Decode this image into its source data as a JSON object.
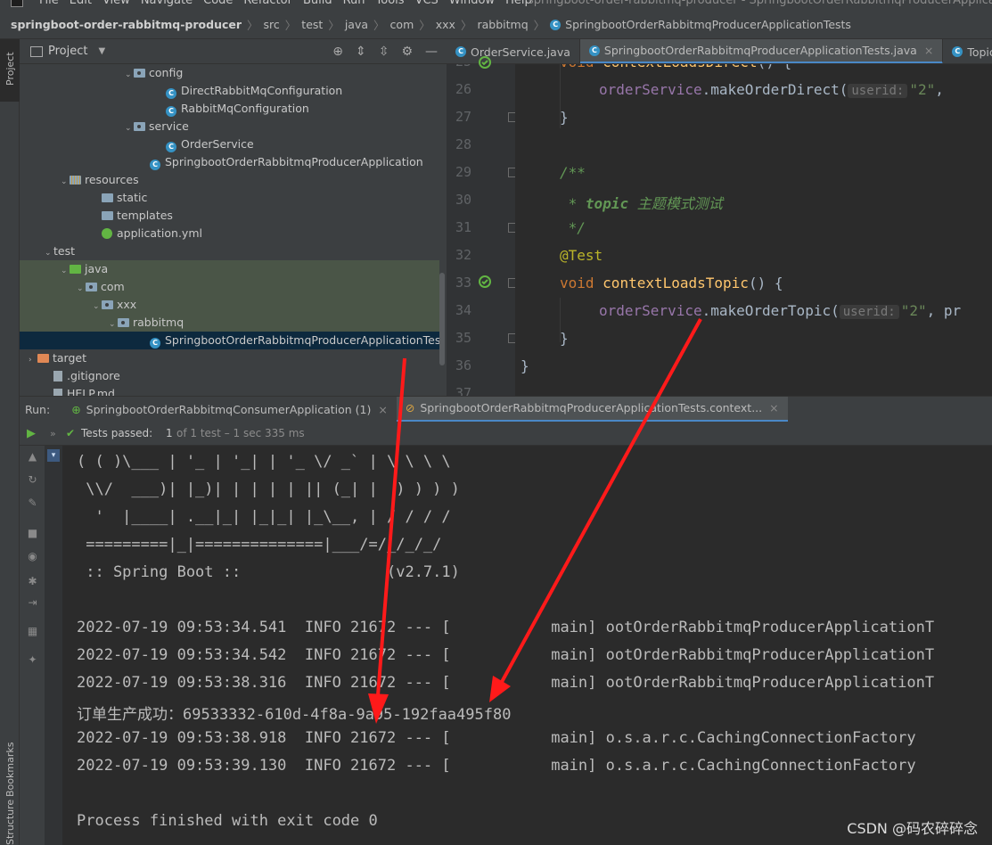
{
  "menubar": {
    "items": [
      "File",
      "Edit",
      "View",
      "Navigate",
      "Code",
      "Refactor",
      "Build",
      "Run",
      "Tools",
      "VCS",
      "Window",
      "Help"
    ],
    "window_title": "springboot-order-rabbitmq-producer - SpringbootOrderRabbitmqProducerApplicationTests"
  },
  "breadcrumb": [
    "springboot-order-rabbitmq-producer",
    "src",
    "test",
    "java",
    "com",
    "xxx",
    "rabbitmq",
    "SpringbootOrderRabbitmqProducerApplicationTests"
  ],
  "left_strip": {
    "project_tab": "Project",
    "bookmarks_tab": "Bookmarks",
    "structure_tab": "Structure"
  },
  "project_panel": {
    "title": "Project",
    "tree": [
      {
        "label": "config",
        "kind": "package",
        "level": 7,
        "arrow": "open"
      },
      {
        "label": "DirectRabbitMqConfiguration",
        "kind": "class",
        "level": 9
      },
      {
        "label": "RabbitMqConfiguration",
        "kind": "class",
        "level": 9
      },
      {
        "label": "service",
        "kind": "package",
        "level": 7,
        "arrow": "open"
      },
      {
        "label": "OrderService",
        "kind": "class",
        "level": 9
      },
      {
        "label": "SpringbootOrderRabbitmqProducerApplication",
        "kind": "springclass",
        "level": 8
      },
      {
        "label": "resources",
        "kind": "resources",
        "level": 3,
        "arrow": "open"
      },
      {
        "label": "static",
        "kind": "folder",
        "level": 5
      },
      {
        "label": "templates",
        "kind": "folder",
        "level": 5
      },
      {
        "label": "application.yml",
        "kind": "yml",
        "level": 5
      },
      {
        "label": "test",
        "kind": "plain",
        "level": 2,
        "arrow": "open"
      },
      {
        "label": "java",
        "kind": "greenfolder",
        "level": 3,
        "arrow": "open",
        "hl": true
      },
      {
        "label": "com",
        "kind": "package",
        "level": 4,
        "arrow": "open",
        "hl": true
      },
      {
        "label": "xxx",
        "kind": "package",
        "level": 5,
        "arrow": "open",
        "hl": true
      },
      {
        "label": "rabbitmq",
        "kind": "package",
        "level": 6,
        "arrow": "open",
        "hl": true
      },
      {
        "label": "SpringbootOrderRabbitmqProducerApplicationTes",
        "kind": "springclass",
        "level": 8,
        "selected": true
      },
      {
        "label": "target",
        "kind": "orangefolder",
        "level": 1,
        "arrow": "closed"
      },
      {
        "label": ".gitignore",
        "kind": "file",
        "level": 2
      },
      {
        "label": "HELP.md",
        "kind": "file",
        "level": 2
      }
    ]
  },
  "editor": {
    "tabs": [
      {
        "label": "OrderService.java",
        "active": false
      },
      {
        "label": "SpringbootOrderRabbitmqProducerApplicationTests.java",
        "active": true
      },
      {
        "label": "TopicEm",
        "active": false
      }
    ],
    "line_numbers": [
      "25",
      "26",
      "27",
      "28",
      "29",
      "30",
      "31",
      "32",
      "33",
      "34",
      "35",
      "36",
      "37"
    ],
    "code": {
      "l25_kw": "void",
      "l25_fn": "contextLoadsDirect",
      "l25_rest": "() {",
      "l26_field": "orderService",
      "l26_call": ".makeOrderDirect(",
      "l26_hint": "userid:",
      "l26_str": "\"2\"",
      "l26_rest": ", ",
      "l27": "}",
      "l29": "/**",
      "l30_star": " * ",
      "l30_tag": "topic",
      "l30_text": " 主题模式测试",
      "l31": " */",
      "l32": "@Test",
      "l33_kw": "void",
      "l33_fn": "contextLoadsTopic",
      "l33_rest": "() {",
      "l34_field": "orderService",
      "l34_call": ".makeOrderTopic(",
      "l34_hint": "userid:",
      "l34_str": "\"2\"",
      "l34_rest": ", pr",
      "l35": "}",
      "l36": "}"
    }
  },
  "run_panel": {
    "label": "Run:",
    "tabs": [
      {
        "label": "SpringbootOrderRabbitmqConsumerApplication (1)",
        "active": false
      },
      {
        "label": "SpringbootOrderRabbitmqProducerApplicationTests.context...",
        "active": true
      }
    ],
    "status_prefix": "Tests passed:",
    "status_count": "1",
    "status_detail": "of 1 test – 1 sec 335 ms",
    "console_lines": [
      "( ( )\\___ | '_ | '_| | '_ \\/ _` | \\ \\ \\ \\",
      " \\\\/  ___)| |_)| | | | | || (_| |  ) ) ) )",
      "  '  |____| .__|_| |_|_| |_\\__, | / / / /",
      " =========|_|==============|___/=/_/_/_/",
      " :: Spring Boot ::                (v2.7.1)",
      "",
      "2022-07-19 09:53:34.541  INFO 21672 --- [           main] ootOrderRabbitmqProducerApplicationT",
      "2022-07-19 09:53:34.542  INFO 21672 --- [           main] ootOrderRabbitmqProducerApplicationT",
      "2022-07-19 09:53:38.316  INFO 21672 --- [           main] ootOrderRabbitmqProducerApplicationT",
      "订单生产成功：69533332-610d-4f8a-9a95-192faa495f80",
      "2022-07-19 09:53:38.918  INFO 21672 --- [           main] o.s.a.r.c.CachingConnectionFactory",
      "2022-07-19 09:53:39.130  INFO 21672 --- [           main] o.s.a.r.c.CachingConnectionFactory",
      "",
      "Process finished with exit code 0"
    ]
  },
  "watermark": "CSDN @码农碎碎念",
  "colors": {
    "annotation_arrow": "#ff1a1a",
    "accent": "#4a88c7",
    "pass_green": "#62b543"
  }
}
